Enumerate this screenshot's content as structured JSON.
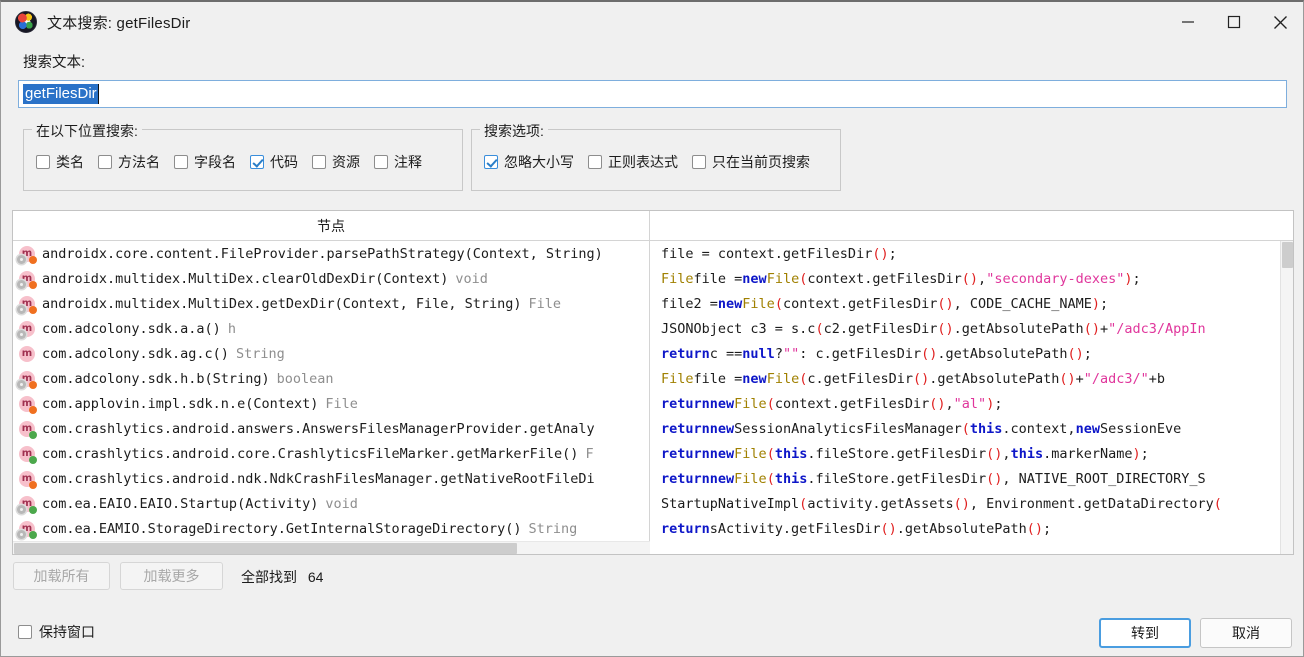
{
  "window": {
    "title": "文本搜索: getFilesDir",
    "icon": "jadx-app-icon",
    "minimize_label": "−",
    "maximize_label": "□",
    "close_label": "✕"
  },
  "search": {
    "label": "搜索文本:",
    "value": "getFilesDir",
    "placeholder": ""
  },
  "groups": {
    "locations": {
      "legend": "在以下位置搜索:",
      "items": [
        {
          "label": "类名",
          "checked": false
        },
        {
          "label": "方法名",
          "checked": false
        },
        {
          "label": "字段名",
          "checked": false
        },
        {
          "label": "代码",
          "checked": true
        },
        {
          "label": "资源",
          "checked": false
        },
        {
          "label": "注释",
          "checked": false
        }
      ]
    },
    "options": {
      "legend": "搜索选项:",
      "items": [
        {
          "label": "忽略大小写",
          "checked": true
        },
        {
          "label": "正则表达式",
          "checked": false
        },
        {
          "label": "只在当前页搜索",
          "checked": false
        }
      ]
    }
  },
  "results": {
    "columns": {
      "node": "节点",
      "code": ""
    },
    "rows": [
      {
        "icon": "method-icon-gear-orange",
        "gear": true,
        "dot": "orange",
        "signature": "androidx.core.content.FileProvider.parsePathStrategy(Context, String)",
        "return_type": "",
        "code": [
          {
            "t": "file = context.getFilesDir",
            "c": "plain"
          },
          {
            "t": "()",
            "c": "paren"
          },
          {
            "t": ";",
            "c": "plain"
          }
        ]
      },
      {
        "icon": "method-icon-gear-orange",
        "gear": true,
        "dot": "orange",
        "signature": "androidx.multidex.MultiDex.clearOldDexDir(Context)",
        "return_type": "void",
        "code": [
          {
            "t": "File",
            "c": "type"
          },
          {
            "t": " file = ",
            "c": "plain"
          },
          {
            "t": "new",
            "c": "kw"
          },
          {
            "t": " ",
            "c": "plain"
          },
          {
            "t": "File",
            "c": "type"
          },
          {
            "t": "(",
            "c": "paren"
          },
          {
            "t": "context.getFilesDir",
            "c": "plain"
          },
          {
            "t": "()",
            "c": "paren"
          },
          {
            "t": ", ",
            "c": "plain"
          },
          {
            "t": "\"secondary-dexes\"",
            "c": "str"
          },
          {
            "t": ")",
            "c": "paren"
          },
          {
            "t": ";",
            "c": "plain"
          }
        ]
      },
      {
        "icon": "method-icon-gear-orange",
        "gear": true,
        "dot": "orange",
        "signature": "androidx.multidex.MultiDex.getDexDir(Context, File, String)",
        "return_type": "File",
        "code": [
          {
            "t": "file2 = ",
            "c": "plain"
          },
          {
            "t": "new",
            "c": "kw"
          },
          {
            "t": " ",
            "c": "plain"
          },
          {
            "t": "File",
            "c": "type"
          },
          {
            "t": "(",
            "c": "paren"
          },
          {
            "t": "context.getFilesDir",
            "c": "plain"
          },
          {
            "t": "()",
            "c": "paren"
          },
          {
            "t": ", CODE_CACHE_NAME",
            "c": "plain"
          },
          {
            "t": ")",
            "c": "paren"
          },
          {
            "t": ";",
            "c": "plain"
          }
        ]
      },
      {
        "icon": "method-icon-gear",
        "gear": true,
        "dot": "none",
        "signature": "com.adcolony.sdk.a.a()",
        "return_type": "h",
        "code": [
          {
            "t": "JSONObject c3 = s.c",
            "c": "plain"
          },
          {
            "t": "(",
            "c": "paren"
          },
          {
            "t": "c2.getFilesDir",
            "c": "plain"
          },
          {
            "t": "()",
            "c": "paren"
          },
          {
            "t": ".getAbsolutePath",
            "c": "plain"
          },
          {
            "t": "()",
            "c": "paren"
          },
          {
            "t": " + ",
            "c": "plain"
          },
          {
            "t": "\"/adc3/AppIn",
            "c": "str"
          }
        ]
      },
      {
        "icon": "method-icon",
        "gear": false,
        "dot": "none",
        "signature": "com.adcolony.sdk.ag.c()",
        "return_type": "String",
        "code": [
          {
            "t": "return",
            "c": "kw"
          },
          {
            "t": " c == ",
            "c": "plain"
          },
          {
            "t": "null",
            "c": "kw"
          },
          {
            "t": " ? ",
            "c": "plain"
          },
          {
            "t": "\"\"",
            "c": "str"
          },
          {
            "t": " : c.getFilesDir",
            "c": "plain"
          },
          {
            "t": "()",
            "c": "paren"
          },
          {
            "t": ".getAbsolutePath",
            "c": "plain"
          },
          {
            "t": "()",
            "c": "paren"
          },
          {
            "t": ";",
            "c": "plain"
          }
        ]
      },
      {
        "icon": "method-icon-gear-orange",
        "gear": true,
        "dot": "orange",
        "signature": "com.adcolony.sdk.h.b(String)",
        "return_type": "boolean",
        "code": [
          {
            "t": "File",
            "c": "type"
          },
          {
            "t": " file = ",
            "c": "plain"
          },
          {
            "t": "new",
            "c": "kw"
          },
          {
            "t": " ",
            "c": "plain"
          },
          {
            "t": "File",
            "c": "type"
          },
          {
            "t": "(",
            "c": "paren"
          },
          {
            "t": "c.getFilesDir",
            "c": "plain"
          },
          {
            "t": "()",
            "c": "paren"
          },
          {
            "t": ".getAbsolutePath",
            "c": "plain"
          },
          {
            "t": "()",
            "c": "paren"
          },
          {
            "t": " + ",
            "c": "plain"
          },
          {
            "t": "\"/adc3/\"",
            "c": "str"
          },
          {
            "t": " + ",
            "c": "plain"
          },
          {
            "t": "b",
            "c": "plain"
          }
        ]
      },
      {
        "icon": "method-icon-orange",
        "gear": false,
        "dot": "orange",
        "signature": "com.applovin.impl.sdk.n.e(Context)",
        "return_type": "File",
        "code": [
          {
            "t": "return",
            "c": "kw"
          },
          {
            "t": " ",
            "c": "plain"
          },
          {
            "t": "new",
            "c": "kw"
          },
          {
            "t": " ",
            "c": "plain"
          },
          {
            "t": "File",
            "c": "type"
          },
          {
            "t": "(",
            "c": "paren"
          },
          {
            "t": "context.getFilesDir",
            "c": "plain"
          },
          {
            "t": "()",
            "c": "paren"
          },
          {
            "t": ", ",
            "c": "plain"
          },
          {
            "t": "\"al\"",
            "c": "str"
          },
          {
            "t": ")",
            "c": "paren"
          },
          {
            "t": ";",
            "c": "plain"
          }
        ]
      },
      {
        "icon": "method-icon-green",
        "gear": false,
        "dot": "green",
        "signature": "com.crashlytics.android.answers.AnswersFilesManagerProvider.getAnaly",
        "return_type": "",
        "code": [
          {
            "t": "return",
            "c": "kw"
          },
          {
            "t": " ",
            "c": "plain"
          },
          {
            "t": "new",
            "c": "kw"
          },
          {
            "t": " SessionAnalyticsFilesManager",
            "c": "plain"
          },
          {
            "t": "(",
            "c": "paren"
          },
          {
            "t": "this",
            "c": "kw"
          },
          {
            "t": ".context, ",
            "c": "plain"
          },
          {
            "t": "new",
            "c": "kw"
          },
          {
            "t": " SessionEve",
            "c": "plain"
          }
        ]
      },
      {
        "icon": "method-icon-green",
        "gear": false,
        "dot": "green",
        "signature": "com.crashlytics.android.core.CrashlyticsFileMarker.getMarkerFile()",
        "return_type": "F",
        "code": [
          {
            "t": "return",
            "c": "kw"
          },
          {
            "t": " ",
            "c": "plain"
          },
          {
            "t": "new",
            "c": "kw"
          },
          {
            "t": " ",
            "c": "plain"
          },
          {
            "t": "File",
            "c": "type"
          },
          {
            "t": "(",
            "c": "paren"
          },
          {
            "t": "this",
            "c": "kw"
          },
          {
            "t": ".fileStore.getFilesDir",
            "c": "plain"
          },
          {
            "t": "()",
            "c": "paren"
          },
          {
            "t": ", ",
            "c": "plain"
          },
          {
            "t": "this",
            "c": "kw"
          },
          {
            "t": ".markerName",
            "c": "plain"
          },
          {
            "t": ")",
            "c": "paren"
          },
          {
            "t": ";",
            "c": "plain"
          }
        ]
      },
      {
        "icon": "method-icon-orange",
        "gear": false,
        "dot": "orange",
        "signature": "com.crashlytics.android.ndk.NdkCrashFilesManager.getNativeRootFileDi",
        "return_type": "",
        "code": [
          {
            "t": "return",
            "c": "kw"
          },
          {
            "t": " ",
            "c": "plain"
          },
          {
            "t": "new",
            "c": "kw"
          },
          {
            "t": " ",
            "c": "plain"
          },
          {
            "t": "File",
            "c": "type"
          },
          {
            "t": "(",
            "c": "paren"
          },
          {
            "t": "this",
            "c": "kw"
          },
          {
            "t": ".fileStore.getFilesDir",
            "c": "plain"
          },
          {
            "t": "()",
            "c": "paren"
          },
          {
            "t": ", NATIVE_ROOT_DIRECTORY_",
            "c": "plain"
          },
          {
            "t": "S",
            "c": "plain"
          }
        ]
      },
      {
        "icon": "method-icon-gear-green",
        "gear": true,
        "dot": "green",
        "signature": "com.ea.EAIO.EAIO.Startup(Activity)",
        "return_type": "void",
        "code": [
          {
            "t": "StartupNativeImpl",
            "c": "plain"
          },
          {
            "t": "(",
            "c": "paren"
          },
          {
            "t": "activity.getAssets",
            "c": "plain"
          },
          {
            "t": "()",
            "c": "paren"
          },
          {
            "t": ", Environment.getDataDirectory",
            "c": "plain"
          },
          {
            "t": "(",
            "c": "paren"
          }
        ]
      },
      {
        "icon": "method-icon-gear-green",
        "gear": true,
        "dot": "green",
        "signature": "com.ea.EAMIO.StorageDirectory.GetInternalStorageDirectory()",
        "return_type": "String",
        "code": [
          {
            "t": "return",
            "c": "kw"
          },
          {
            "t": " sActivity.getFilesDir",
            "c": "plain"
          },
          {
            "t": "()",
            "c": "paren"
          },
          {
            "t": ".getAbsolutePath",
            "c": "plain"
          },
          {
            "t": "()",
            "c": "paren"
          },
          {
            "t": ";",
            "c": "plain"
          }
        ]
      }
    ]
  },
  "footer": {
    "load_all": "加载所有",
    "load_more": "加载更多",
    "found_label": "全部找到",
    "found_count": "64",
    "keep_window": "保持窗口",
    "keep_window_checked": false,
    "goto": "转到",
    "cancel": "取消"
  },
  "colors": {
    "accent": "#4a9de0",
    "selection": "#2a72c8",
    "keyword": "#0d16c8",
    "string": "#e0369c",
    "type": "#a08000",
    "paren": "#e02020",
    "icon_pink": "#f7c0cb",
    "dot_orange": "#f07020",
    "dot_green": "#4ca84c"
  }
}
